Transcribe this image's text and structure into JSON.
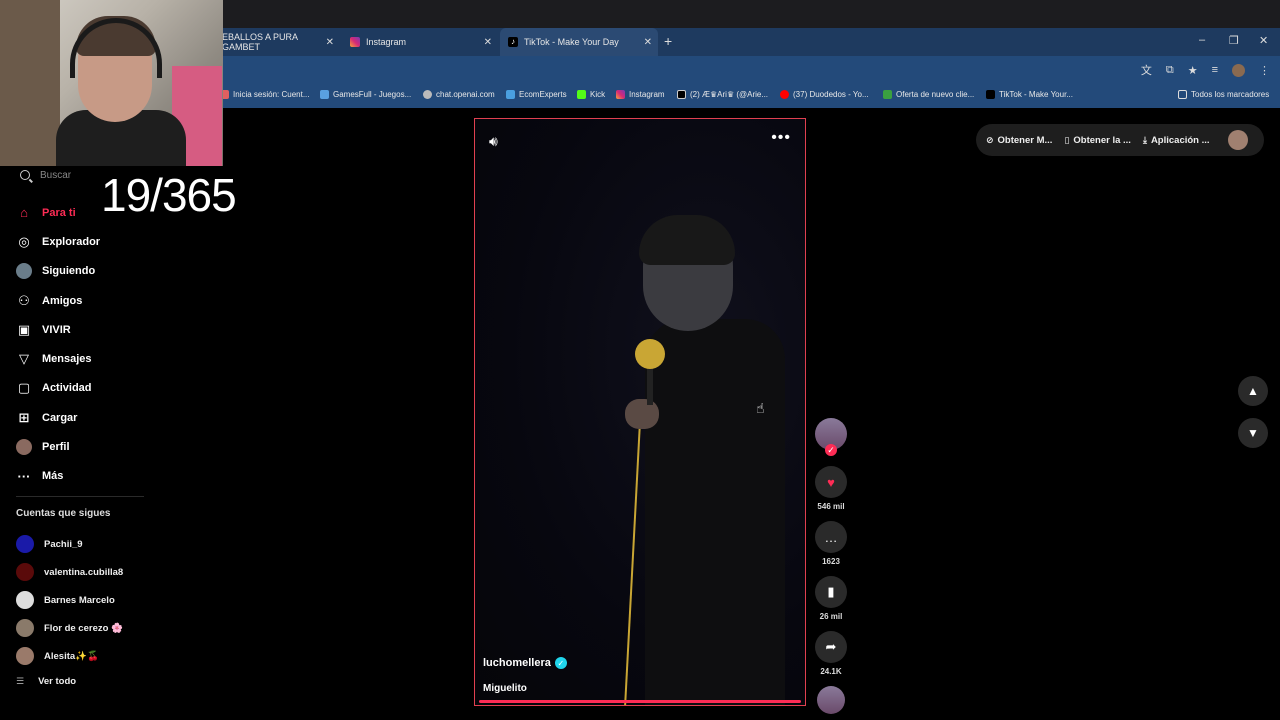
{
  "browser": {
    "tabs": [
      {
        "label": "EBALLOS A PURA GAMBET",
        "close": "✕"
      },
      {
        "label": "Instagram",
        "close": "✕"
      },
      {
        "label": "TikTok - Make Your Day",
        "close": "✕"
      }
    ],
    "new_tab": "+",
    "window_controls": {
      "minimize": "–",
      "restore": "❐",
      "close": "✕"
    },
    "bookmarks": [
      "Inicia sesión: Cuent...",
      "GamesFull - Juegos...",
      "chat.openai.com",
      "EcomExperts",
      "Kick",
      "Instagram",
      "(2) Æ♛Ari♛ (@Arie...",
      "(37) Duodedos - Yo...",
      "Oferta de nuevo clie...",
      "TikTok - Make Your..."
    ],
    "all_bookmarks": "Todos los marcadores"
  },
  "overlay": {
    "counter": "19/365"
  },
  "sidebar": {
    "search_placeholder": "Buscar",
    "nav": [
      {
        "label": "Para ti",
        "icon": "home-icon",
        "active": true
      },
      {
        "label": "Explorador",
        "icon": "compass-icon"
      },
      {
        "label": "Siguiendo",
        "icon": "following-avatar-icon"
      },
      {
        "label": "Amigos",
        "icon": "friends-icon"
      },
      {
        "label": "VIVIR",
        "icon": "live-icon"
      },
      {
        "label": "Mensajes",
        "icon": "messages-icon"
      },
      {
        "label": "Actividad",
        "icon": "activity-icon"
      },
      {
        "label": "Cargar",
        "icon": "upload-icon"
      },
      {
        "label": "Perfil",
        "icon": "profile-avatar-icon"
      },
      {
        "label": "Más",
        "icon": "more-icon"
      }
    ],
    "following_title": "Cuentas que sigues",
    "following": [
      {
        "name": "Pachii_9",
        "color": "#1a1aa8"
      },
      {
        "name": "valentina.cubilla8",
        "color": "#5a0a0a"
      },
      {
        "name": "Barnes Marcelo",
        "color": "#dddddd"
      },
      {
        "name": "Flor de cerezo 🌸",
        "color": "#8a7a6a"
      },
      {
        "name": "Alesita✨🍒",
        "color": "#9a7a6a"
      }
    ],
    "see_all": "Ver todo"
  },
  "video": {
    "author": "luchomellera",
    "caption": "Miguelito",
    "progress": 1.0
  },
  "actions": {
    "likes": "546 mil",
    "comments": "1623",
    "saves": "26 mil",
    "shares": "24.1K"
  },
  "top_pill": {
    "coins": "Obtener M...",
    "app": "Obtener la ...",
    "download": "Aplicación ..."
  },
  "colors": {
    "accent": "#fe2c55",
    "browser_chrome": "#234a7a"
  }
}
